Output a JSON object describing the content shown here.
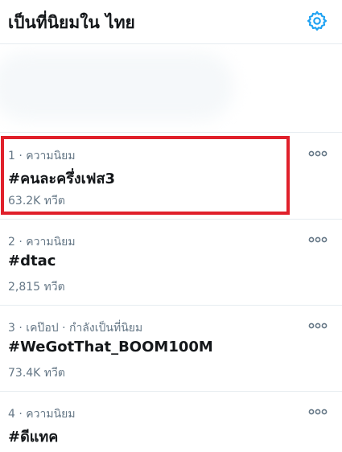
{
  "header": {
    "title": "เป็นที่นิยมใน ไทย",
    "settings_icon": "gear-icon",
    "accent_color": "#1da1f2"
  },
  "trends": [
    {
      "rank": "1",
      "context": "ความนิยม",
      "name": "#คนละครึ่งเฟส3",
      "count": "63.2K ทวีต"
    },
    {
      "rank": "2",
      "context": "ความนิยม",
      "name": "#dtac",
      "count": "2,815 ทวีต"
    },
    {
      "rank": "3",
      "context": "เคป๊อป · กำลังเป็นที่นิยม",
      "name": "#WeGotThat_BOOM100M",
      "count": "73.4K ทวีต"
    },
    {
      "rank": "4",
      "context": "ความนิยม",
      "name": "#ดีแทค",
      "count": ""
    }
  ],
  "highlight_color": "#e0202b",
  "more_icon": "more-dots-icon"
}
